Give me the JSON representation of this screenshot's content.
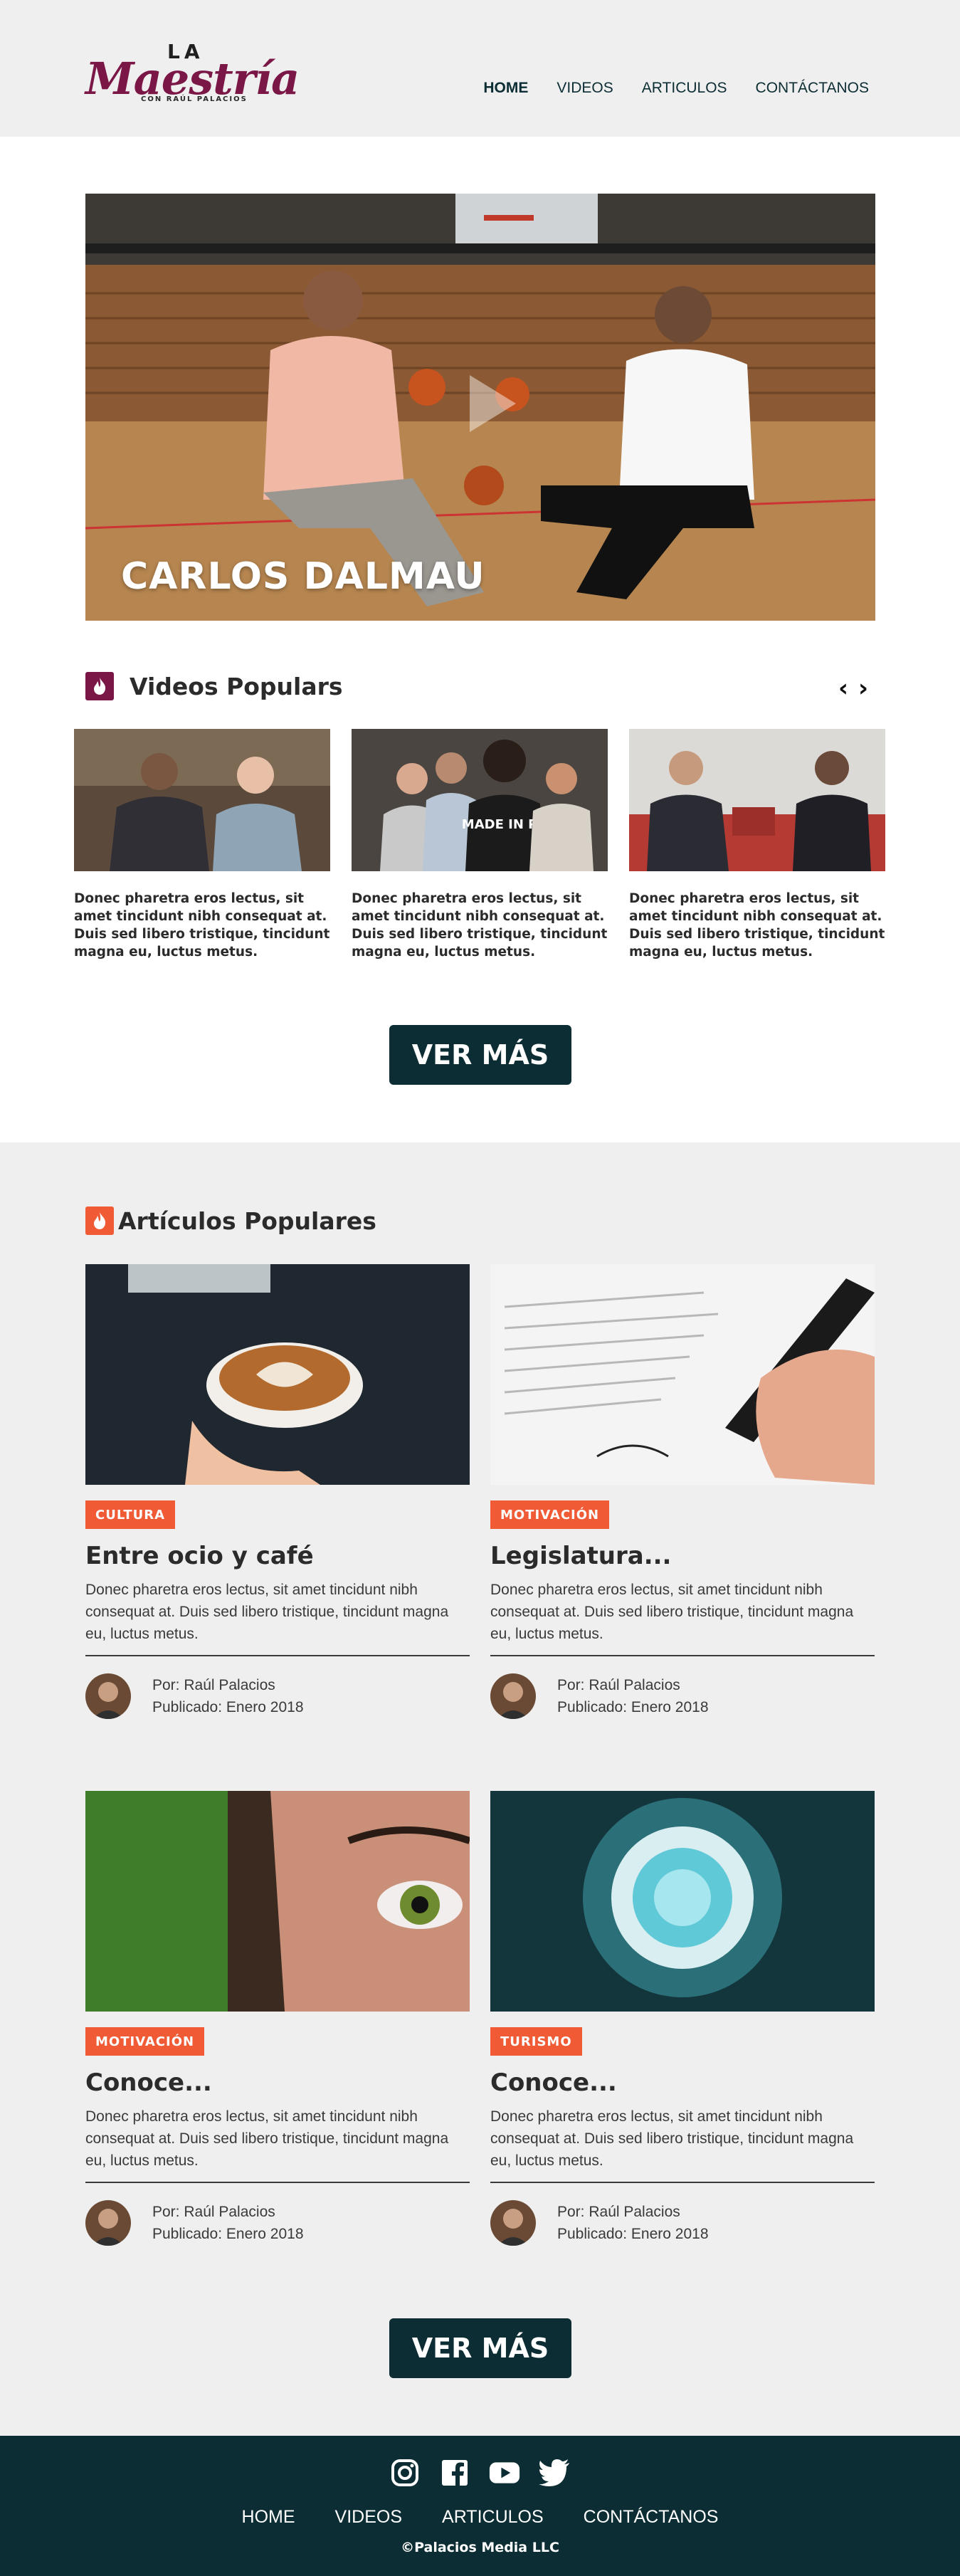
{
  "brand": {
    "logo_top": "LA",
    "logo_main": "Maestría",
    "logo_sub": "CON RAÚL PALACIOS"
  },
  "nav": {
    "items": [
      {
        "label": "HOME",
        "active": true
      },
      {
        "label": "VIDEOS",
        "active": false
      },
      {
        "label": "ARTICULOS",
        "active": false
      },
      {
        "label": "CONTÁCTANOS",
        "active": false
      }
    ]
  },
  "hero": {
    "title": "CARLOS DALMAU",
    "play_icon": "play-icon"
  },
  "videos": {
    "heading": "Videos Populars",
    "heading_icon": "flame-icon",
    "prev_icon": "chevron-left-icon",
    "next_icon": "chevron-right-icon",
    "cards": [
      {
        "caption": "Donec pharetra eros lectus, sit amet tincidunt nibh consequat at. Duis sed libero tristique, tincidunt magna eu, luctus metus."
      },
      {
        "caption": "Donec pharetra eros lectus, sit amet tincidunt nibh consequat at. Duis sed libero tristique, tincidunt magna eu, luctus metus.",
        "shirt_text": "MADE IN PR"
      },
      {
        "caption": "Donec pharetra eros lectus, sit amet tincidunt nibh consequat at. Duis sed libero tristique, tincidunt magna eu, luctus metus."
      }
    ],
    "more_label": "VER MÁS"
  },
  "articles": {
    "heading": "Artículos Populares",
    "heading_icon": "flame-icon",
    "cards": [
      {
        "category": "CULTURA",
        "title": "Entre ocio y café",
        "excerpt": "Donec pharetra eros lectus, sit amet tincidunt nibh consequat at. Duis sed libero tristique, tincidunt magna eu, luctus metus.",
        "author": "Por: Raúl Palacios",
        "published": "Publicado: Enero 2018"
      },
      {
        "category": "MOTIVACIÓN",
        "title": "Legislatura...",
        "excerpt": "Donec pharetra eros lectus, sit amet tincidunt nibh consequat at. Duis sed libero tristique, tincidunt magna eu, luctus metus.",
        "author": "Por: Raúl Palacios",
        "published": "Publicado: Enero 2018"
      },
      {
        "category": "MOTIVACIÓN",
        "title": "Conoce...",
        "excerpt": "Donec pharetra eros lectus, sit amet tincidunt nibh consequat at. Duis sed libero tristique, tincidunt magna eu, luctus metus.",
        "author": "Por: Raúl Palacios",
        "published": "Publicado: Enero 2018"
      },
      {
        "category": "TURISMO",
        "title": "Conoce...",
        "excerpt": "Donec pharetra eros lectus, sit amet tincidunt nibh consequat at. Duis sed libero tristique, tincidunt magna eu, luctus metus.",
        "author": "Por: Raúl Palacios",
        "published": "Publicado: Enero 2018"
      }
    ],
    "more_label": "VER MÁS"
  },
  "footer": {
    "social": [
      "instagram-icon",
      "facebook-icon",
      "youtube-icon",
      "twitter-icon"
    ],
    "nav": [
      "HOME",
      "VIDEOS",
      "ARTICULOS",
      "CONTÁCTANOS"
    ],
    "copyright": "©Palacios Media LLC"
  },
  "colors": {
    "accent": "#f05a35",
    "brand": "#7a1747",
    "dark": "#0b2d33",
    "section_bg": "#efefef"
  }
}
